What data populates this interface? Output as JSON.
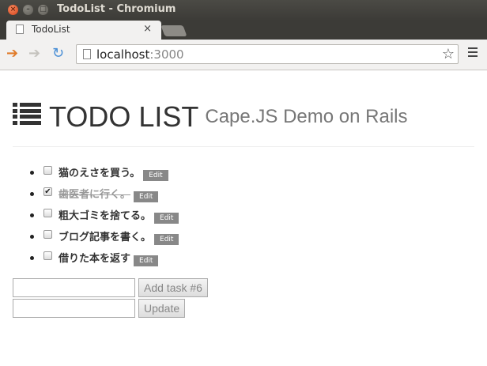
{
  "window": {
    "title": "TodoList - Chromium"
  },
  "tab": {
    "title": "TodoList",
    "close": "×"
  },
  "address_bar": {
    "host": "localhost",
    "port": ":3000"
  },
  "page": {
    "title": "TODO LIST",
    "subtitle": "Cape.JS Demo on Rails",
    "tasks": [
      {
        "label": "猫のえさを買う。",
        "done": false,
        "edit": "Edit"
      },
      {
        "label": "歯医者に行く。",
        "done": true,
        "edit": "Edit"
      },
      {
        "label": "粗大ゴミを捨てる。",
        "done": false,
        "edit": "Edit"
      },
      {
        "label": "ブログ記事を書く。",
        "done": false,
        "edit": "Edit"
      },
      {
        "label": "借りた本を返す",
        "done": false,
        "edit": "Edit"
      }
    ],
    "add_button": "Add task #6",
    "update_button": "Update"
  },
  "icons": {
    "back": "back-arrow-icon",
    "forward": "forward-arrow-icon",
    "reload": "reload-icon",
    "bookmark": "star-icon",
    "menu": "menu-icon",
    "list": "list-icon"
  },
  "colors": {
    "back_arrow": "#e07b2a",
    "reload": "#4a8fd6",
    "edit_button": "#888888"
  }
}
